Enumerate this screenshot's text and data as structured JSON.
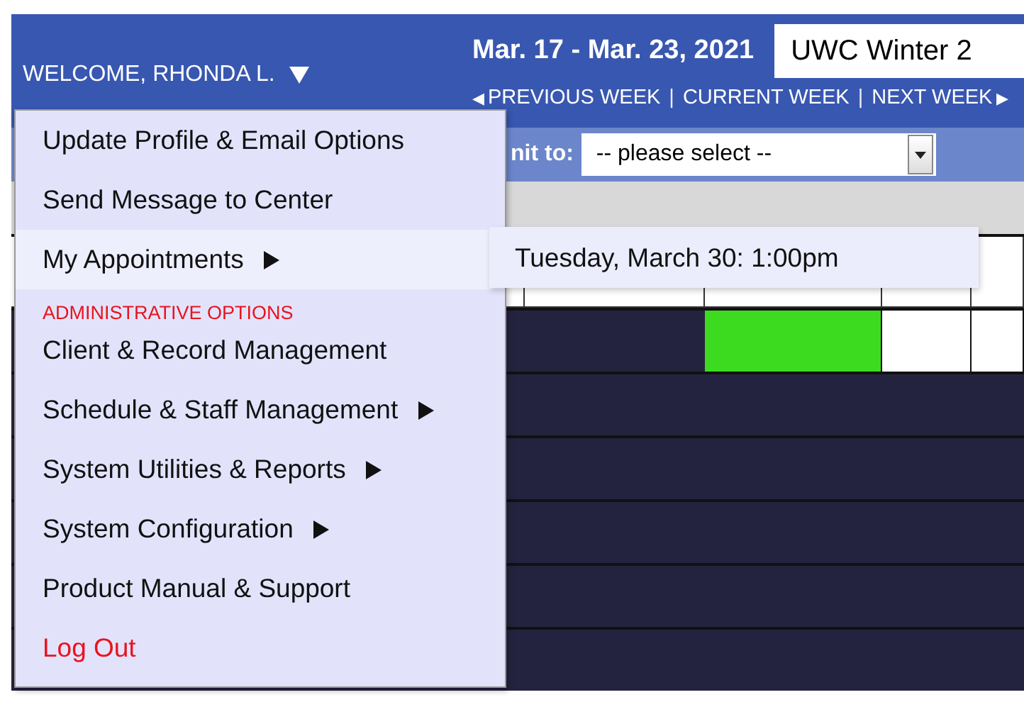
{
  "header": {
    "user_menu": "WELCOME, RHONDA L.",
    "week_range": "Mar. 17 - Mar. 23, 2021",
    "schedule_select": "UWC Winter 2",
    "nav": [
      {
        "label": "PREVIOUS WEEK",
        "arrow": "◀"
      },
      {
        "separator": "|"
      },
      {
        "label": "CURRENT WEEK"
      },
      {
        "separator": "|"
      },
      {
        "label": "NEXT WEEK",
        "arrow": "▶"
      }
    ]
  },
  "filter": {
    "label": "nit to:",
    "value": "-- please select --"
  },
  "schedule": {
    "rows": [
      {
        "slots": [
          {
            "kind": "blocked"
          },
          {
            "kind": "blocked"
          },
          {
            "kind": "open"
          },
          {
            "kind": "free"
          },
          {
            "kind": "free"
          }
        ]
      },
      {
        "slots": [
          {
            "kind": "blocked"
          },
          {
            "kind": "blocked"
          },
          {
            "kind": "blocked"
          },
          {
            "kind": "blocked"
          },
          {
            "kind": "blocked"
          }
        ]
      },
      {
        "slots": [
          {
            "kind": "blocked"
          },
          {
            "kind": "blocked"
          },
          {
            "kind": "blocked"
          },
          {
            "kind": "blocked"
          },
          {
            "kind": "blocked"
          }
        ]
      },
      {
        "slots": [
          {
            "kind": "blocked"
          },
          {
            "kind": "blocked"
          },
          {
            "kind": "blocked"
          },
          {
            "kind": "blocked"
          },
          {
            "kind": "blocked"
          }
        ]
      },
      {
        "slots": [
          {
            "kind": "blocked"
          },
          {
            "kind": "blocked"
          },
          {
            "kind": "blocked"
          },
          {
            "kind": "blocked"
          },
          {
            "kind": "blocked"
          }
        ]
      },
      {
        "slots": [
          {
            "kind": "blocked"
          },
          {
            "kind": "blocked"
          },
          {
            "kind": "blocked"
          },
          {
            "kind": "blocked"
          },
          {
            "kind": "blocked"
          }
        ]
      }
    ]
  },
  "user_dropdown": {
    "items": [
      {
        "kind": "item",
        "label": "Update Profile & Email Options",
        "has_submenu": false,
        "selected": false
      },
      {
        "kind": "item",
        "label": "Send Message to Center",
        "has_submenu": false,
        "selected": false
      },
      {
        "kind": "item",
        "label": "My Appointments",
        "has_submenu": true,
        "selected": true
      },
      {
        "kind": "heading",
        "label": "ADMINISTRATIVE OPTIONS"
      },
      {
        "kind": "item",
        "label": "Client & Record Management",
        "has_submenu": false,
        "selected": false
      },
      {
        "kind": "item",
        "label": "Schedule & Staff Management",
        "has_submenu": true,
        "selected": false
      },
      {
        "kind": "item",
        "label": "System Utilities & Reports",
        "has_submenu": true,
        "selected": false
      },
      {
        "kind": "item",
        "label": "System Configuration",
        "has_submenu": true,
        "selected": false
      },
      {
        "kind": "item",
        "label": "Product Manual & Support",
        "has_submenu": false,
        "selected": false
      },
      {
        "kind": "logout",
        "label": "Log Out",
        "has_submenu": false,
        "selected": false
      }
    ],
    "submenu": [
      "Tuesday, March 30: 1:00pm"
    ]
  }
}
